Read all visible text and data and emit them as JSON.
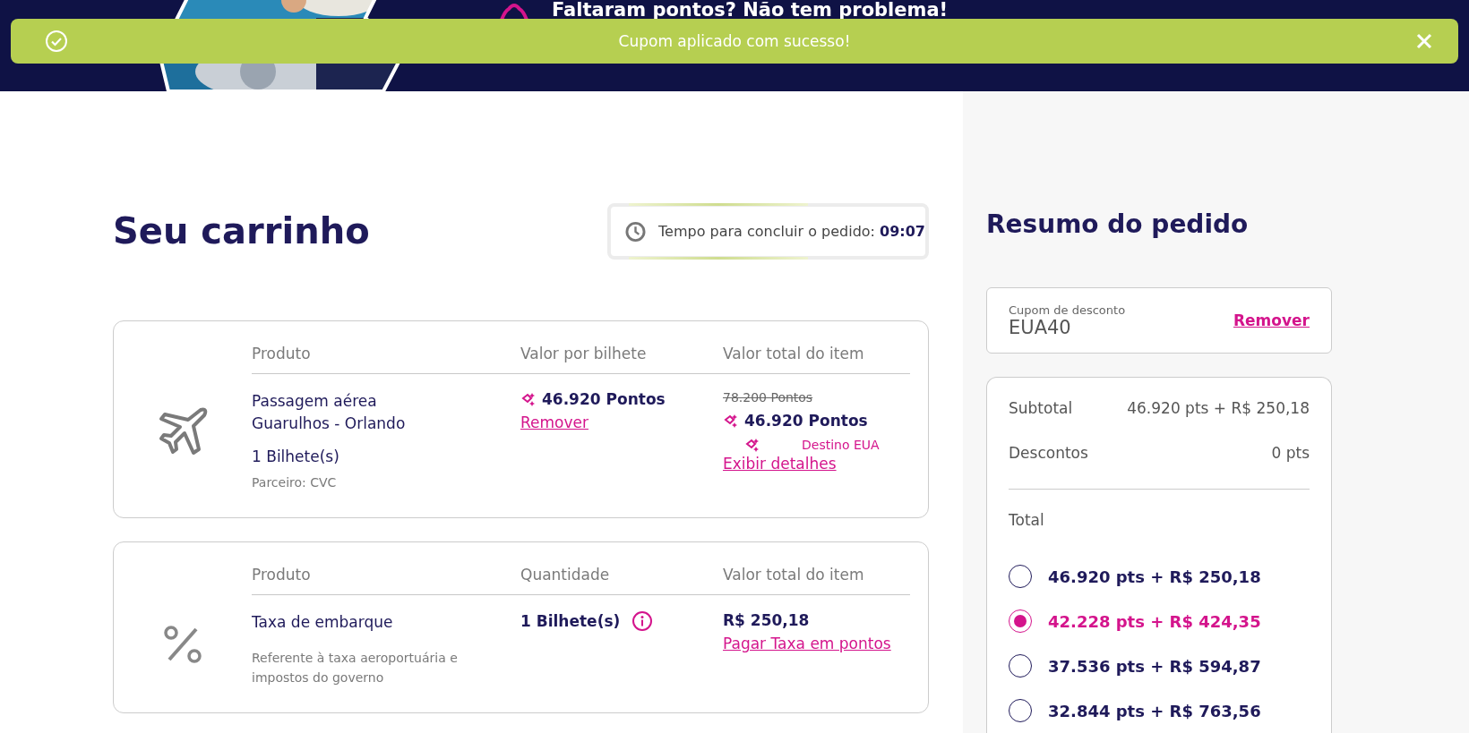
{
  "header": {
    "promo_title": "Faltaram pontos? Não tem problema!"
  },
  "toast": {
    "message": "Cupom aplicado com sucesso!"
  },
  "cart": {
    "title": "Seu carrinho",
    "timer": {
      "label": "Tempo para concluir o pedido:",
      "value": "09:07"
    },
    "items": [
      {
        "kind": "flight",
        "columns": [
          "Produto",
          "Valor por bilhete",
          "Valor total do item"
        ],
        "name_lines": [
          "Passagem aérea",
          "Guarulhos - Orlando"
        ],
        "quantity": "1 Bilhete(s)",
        "note": "Parceiro: CVC",
        "unit_value": "46.920 Pontos",
        "remove_link": "Remover",
        "old_total": "78.200 Pontos",
        "total": "46.920 Pontos",
        "promo_tag": "Destino EUA",
        "details_link": "Exibir detalhes"
      },
      {
        "kind": "fee",
        "columns": [
          "Produto",
          "Quantidade",
          "Valor total do item"
        ],
        "name_lines": [
          "Taxa de embarque"
        ],
        "note": "Referente à taxa aeroportuária e impostos do governo",
        "quantity": "1 Bilhete(s)",
        "total": "R$ 250,18",
        "pay_link": "Pagar Taxa em pontos"
      }
    ]
  },
  "summary": {
    "title": "Resumo do pedido",
    "coupon": {
      "label": "Cupom de desconto",
      "value": "EUA40",
      "remove_link": "Remover"
    },
    "subtotal": {
      "label": "Subtotal",
      "value": "46.920 pts + R$ 250,18"
    },
    "discounts": {
      "label": "Descontos",
      "value": "0 pts"
    },
    "total_label": "Total",
    "options": [
      {
        "label": "46.920 pts + R$ 250,18",
        "selected": false
      },
      {
        "label": "42.228 pts + R$ 424,35",
        "selected": true
      },
      {
        "label": "37.536 pts + R$ 594,87",
        "selected": false
      },
      {
        "label": "32.844 pts + R$ 763,56",
        "selected": false
      }
    ]
  }
}
